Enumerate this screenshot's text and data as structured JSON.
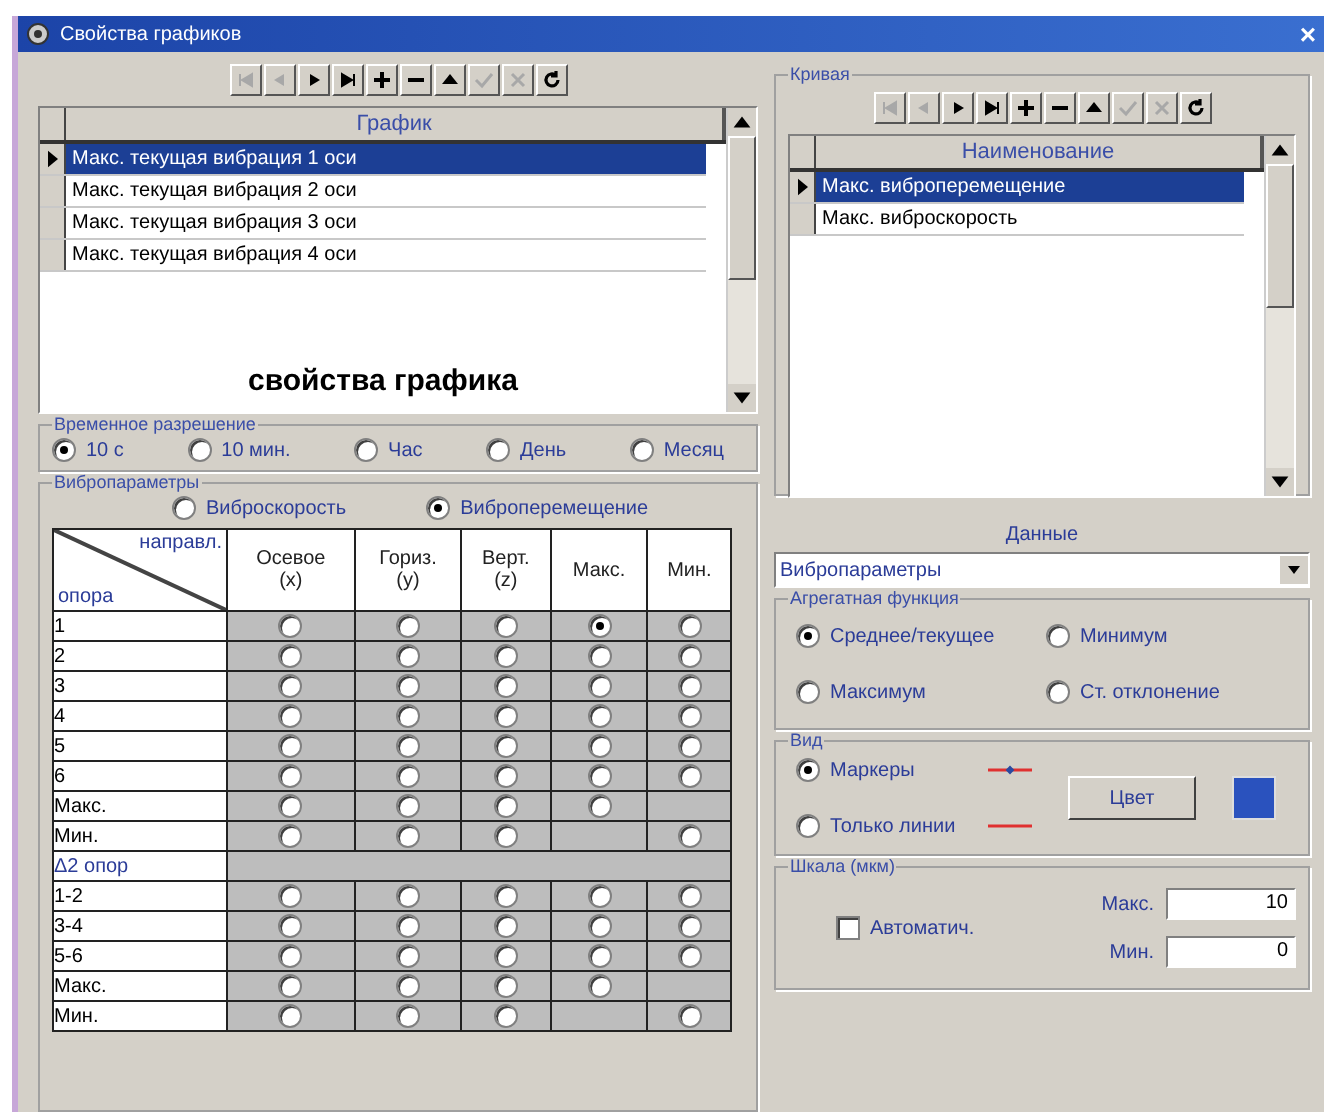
{
  "window": {
    "title": "Свойства графиков",
    "close": "×"
  },
  "graph_panel": {
    "toolbar": [
      {
        "kind": "first",
        "disabled": true
      },
      {
        "kind": "prior",
        "disabled": true
      },
      {
        "kind": "next",
        "disabled": false
      },
      {
        "kind": "last",
        "disabled": false
      },
      {
        "kind": "insert",
        "disabled": false
      },
      {
        "kind": "delete",
        "disabled": false
      },
      {
        "kind": "edit",
        "disabled": false
      },
      {
        "kind": "post",
        "disabled": true
      },
      {
        "kind": "cancel",
        "disabled": true
      },
      {
        "kind": "refresh",
        "disabled": false
      }
    ],
    "column": "График",
    "rows": [
      {
        "label": "Макс. текущая вибрация 1 оси",
        "selected": true
      },
      {
        "label": "Макс. текущая вибрация 2 оси",
        "selected": false
      },
      {
        "label": "Макс. текущая вибрация 3 оси",
        "selected": false
      },
      {
        "label": "Макс. текущая вибрация 4 оси",
        "selected": false
      }
    ],
    "caption": "свойства графика"
  },
  "time_resolution": {
    "label": "Временное разрешение",
    "options": [
      {
        "label": "10 с",
        "selected": true
      },
      {
        "label": "10 мин.",
        "selected": false
      },
      {
        "label": "Час",
        "selected": false
      },
      {
        "label": "День",
        "selected": false
      },
      {
        "label": "Месяц",
        "selected": false
      }
    ]
  },
  "vibro": {
    "label": "Вибропараметры",
    "modes": [
      {
        "label": "Виброскорость",
        "selected": false
      },
      {
        "label": "Виброперемещение",
        "selected": true
      }
    ],
    "corner_top": "направл.",
    "corner_bottom": "опора",
    "columns": [
      "Осевое\n(x)",
      "Гориз.\n(y)",
      "Верт.\n(z)",
      "Макс.",
      "Мин."
    ],
    "rows": [
      {
        "kind": "data",
        "label": "1",
        "cells": [
          {
            "kind": "radio",
            "selected": false
          },
          {
            "kind": "radio",
            "selected": false
          },
          {
            "kind": "radio",
            "selected": false
          },
          {
            "kind": "radio",
            "selected": true
          },
          {
            "kind": "radio",
            "selected": false
          }
        ]
      },
      {
        "kind": "data",
        "label": "2",
        "cells": [
          {
            "kind": "radio",
            "selected": false
          },
          {
            "kind": "radio",
            "selected": false
          },
          {
            "kind": "radio",
            "selected": false
          },
          {
            "kind": "radio",
            "selected": false
          },
          {
            "kind": "radio",
            "selected": false
          }
        ]
      },
      {
        "kind": "data",
        "label": "3",
        "cells": [
          {
            "kind": "radio",
            "selected": false
          },
          {
            "kind": "radio",
            "selected": false
          },
          {
            "kind": "radio",
            "selected": false
          },
          {
            "kind": "radio",
            "selected": false
          },
          {
            "kind": "radio",
            "selected": false
          }
        ]
      },
      {
        "kind": "data",
        "label": "4",
        "cells": [
          {
            "kind": "radio",
            "selected": false
          },
          {
            "kind": "radio",
            "selected": false
          },
          {
            "kind": "radio",
            "selected": false
          },
          {
            "kind": "radio",
            "selected": false
          },
          {
            "kind": "radio",
            "selected": false
          }
        ]
      },
      {
        "kind": "data",
        "label": "5",
        "cells": [
          {
            "kind": "radio",
            "selected": false
          },
          {
            "kind": "radio",
            "selected": false
          },
          {
            "kind": "radio",
            "selected": false
          },
          {
            "kind": "radio",
            "selected": false
          },
          {
            "kind": "radio",
            "selected": false
          }
        ]
      },
      {
        "kind": "data",
        "label": "6",
        "cells": [
          {
            "kind": "radio",
            "selected": false
          },
          {
            "kind": "radio",
            "selected": false
          },
          {
            "kind": "radio",
            "selected": false
          },
          {
            "kind": "radio",
            "selected": false
          },
          {
            "kind": "radio",
            "selected": false
          }
        ]
      },
      {
        "kind": "data",
        "label": "Макс.",
        "cells": [
          {
            "kind": "radio",
            "selected": false
          },
          {
            "kind": "radio",
            "selected": false
          },
          {
            "kind": "radio",
            "selected": false
          },
          {
            "kind": "radio",
            "selected": false
          },
          {
            "kind": "empty"
          }
        ]
      },
      {
        "kind": "data",
        "label": "Мин.",
        "cells": [
          {
            "kind": "radio",
            "selected": false
          },
          {
            "kind": "radio",
            "selected": false
          },
          {
            "kind": "radio",
            "selected": false
          },
          {
            "kind": "empty"
          },
          {
            "kind": "radio",
            "selected": false
          }
        ]
      },
      {
        "kind": "section",
        "label": "Δ2 опор"
      },
      {
        "kind": "data",
        "label": "1-2",
        "cells": [
          {
            "kind": "radio",
            "selected": false
          },
          {
            "kind": "radio",
            "selected": false
          },
          {
            "kind": "radio",
            "selected": false
          },
          {
            "kind": "radio",
            "selected": false
          },
          {
            "kind": "radio",
            "selected": false
          }
        ]
      },
      {
        "kind": "data",
        "label": "3-4",
        "cells": [
          {
            "kind": "radio",
            "selected": false
          },
          {
            "kind": "radio",
            "selected": false
          },
          {
            "kind": "radio",
            "selected": false
          },
          {
            "kind": "radio",
            "selected": false
          },
          {
            "kind": "radio",
            "selected": false
          }
        ]
      },
      {
        "kind": "data",
        "label": "5-6",
        "cells": [
          {
            "kind": "radio",
            "selected": false
          },
          {
            "kind": "radio",
            "selected": false
          },
          {
            "kind": "radio",
            "selected": false
          },
          {
            "kind": "radio",
            "selected": false
          },
          {
            "kind": "radio",
            "selected": false
          }
        ]
      },
      {
        "kind": "data",
        "label": "Макс.",
        "cells": [
          {
            "kind": "radio",
            "selected": false
          },
          {
            "kind": "radio",
            "selected": false
          },
          {
            "kind": "radio",
            "selected": false
          },
          {
            "kind": "radio",
            "selected": false
          },
          {
            "kind": "empty"
          }
        ]
      },
      {
        "kind": "data",
        "label": "Мин.",
        "cells": [
          {
            "kind": "radio",
            "selected": false
          },
          {
            "kind": "radio",
            "selected": false
          },
          {
            "kind": "radio",
            "selected": false
          },
          {
            "kind": "empty"
          },
          {
            "kind": "radio",
            "selected": false
          }
        ]
      }
    ]
  },
  "curve_panel": {
    "label": "Кривая",
    "toolbar": [
      {
        "kind": "first",
        "disabled": true
      },
      {
        "kind": "prior",
        "disabled": true
      },
      {
        "kind": "next",
        "disabled": false
      },
      {
        "kind": "last",
        "disabled": false
      },
      {
        "kind": "insert",
        "disabled": false
      },
      {
        "kind": "delete",
        "disabled": false
      },
      {
        "kind": "edit",
        "disabled": false
      },
      {
        "kind": "post",
        "disabled": true
      },
      {
        "kind": "cancel",
        "disabled": true
      },
      {
        "kind": "refresh",
        "disabled": false
      }
    ],
    "column": "Наименование",
    "rows": [
      {
        "label": "Макс. виброперемещение",
        "selected": true
      },
      {
        "label": "Макс. виброскорость",
        "selected": false
      }
    ]
  },
  "data": {
    "label": "Данные",
    "value": "Вибропараметры"
  },
  "aggregate": {
    "label": "Агрегатная функция",
    "options": [
      {
        "label": "Среднее/текущее",
        "selected": true
      },
      {
        "label": "Минимум",
        "selected": false
      },
      {
        "label": "Максимум",
        "selected": false
      },
      {
        "label": "Ст. отклонение",
        "selected": false
      }
    ]
  },
  "view": {
    "label": "Вид",
    "options": [
      {
        "label": "Маркеры",
        "selected": true,
        "kind": "markers"
      },
      {
        "label": "Только линии",
        "selected": false,
        "kind": "line"
      }
    ],
    "color_button": "Цвет",
    "color": "#2a52be"
  },
  "scale": {
    "label": "Шкала (мкм)",
    "auto": {
      "label": "Автоматич.",
      "checked": false
    },
    "max": {
      "label": "Макс.",
      "value": "10"
    },
    "min": {
      "label": "Мин.",
      "value": "0"
    }
  }
}
